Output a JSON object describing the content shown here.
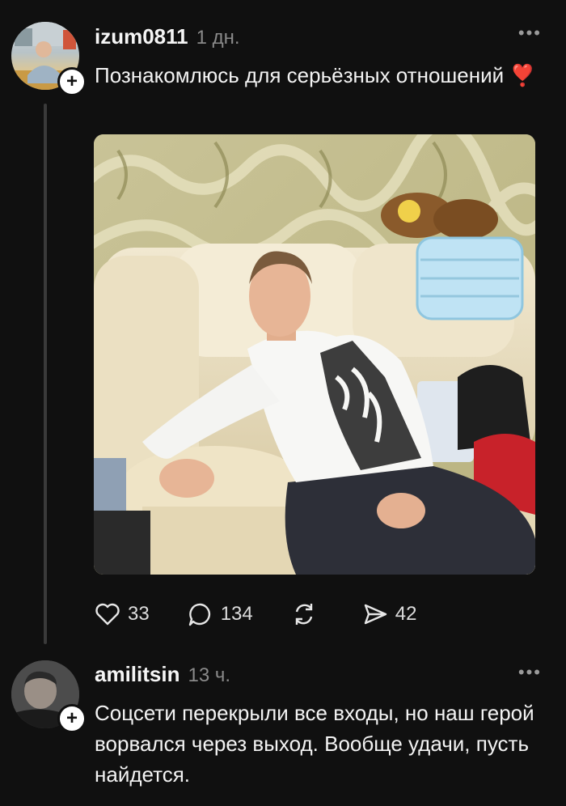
{
  "post": {
    "username": "izum0811",
    "time": "1 дн.",
    "text": "Познакомлюсь для серьёзных отношений ❣️",
    "more": "•••",
    "follow": "+",
    "actions": {
      "likes": "33",
      "comments": "134",
      "reposts": "",
      "shares": "42"
    }
  },
  "reply": {
    "username": "amilitsin",
    "time": "13 ч.",
    "text": "Соцсети перекрыли все входы, но наш герой ворвался через выход. Вообще удачи, пусть найдется.",
    "more": "•••",
    "follow": "+"
  },
  "icons": [
    "heart-icon",
    "comment-icon",
    "repost-icon",
    "send-icon",
    "more-icon",
    "plus-icon"
  ],
  "colors": {
    "background": "#101010",
    "text": "#f3f3f3",
    "muted": "#8a8a8a",
    "thread": "#3a3a3a"
  }
}
